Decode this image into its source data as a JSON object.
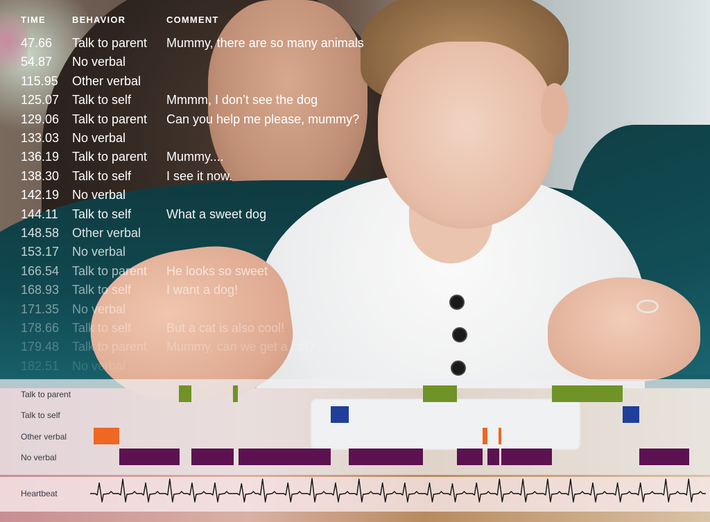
{
  "log": {
    "headers": {
      "time": "TIME",
      "behavior": "BEHAVIOR",
      "comment": "COMMENT"
    },
    "rows": [
      {
        "time": "47.66",
        "behavior": "Talk to parent",
        "comment": "Mummy, there are so many animals",
        "opacity": 1.0
      },
      {
        "time": "54.87",
        "behavior": "No verbal",
        "comment": "",
        "opacity": 1.0
      },
      {
        "time": "115.95",
        "behavior": "Other verbal",
        "comment": "",
        "opacity": 1.0
      },
      {
        "time": "125.07",
        "behavior": "Talk to self",
        "comment": "Mmmm, I don’t see the dog",
        "opacity": 1.0
      },
      {
        "time": "129.06",
        "behavior": "Talk to parent",
        "comment": "Can you help me please, mummy?",
        "opacity": 1.0
      },
      {
        "time": "133.03",
        "behavior": "No verbal",
        "comment": "",
        "opacity": 1.0
      },
      {
        "time": "136.19",
        "behavior": "Talk to parent",
        "comment": "Mummy....",
        "opacity": 1.0
      },
      {
        "time": "138.30",
        "behavior": "Talk to self",
        "comment": "I see it now.",
        "opacity": 1.0
      },
      {
        "time": "142.19",
        "behavior": "No verbal",
        "comment": "",
        "opacity": 1.0
      },
      {
        "time": "144.11",
        "behavior": "Talk to self",
        "comment": "What a sweet dog",
        "opacity": 0.95
      },
      {
        "time": "148.58",
        "behavior": "Other verbal",
        "comment": "",
        "opacity": 0.85
      },
      {
        "time": "153.17",
        "behavior": "No verbal",
        "comment": "",
        "opacity": 0.75
      },
      {
        "time": "166.54",
        "behavior": "Talk to parent",
        "comment": "He looks so sweet",
        "opacity": 0.65
      },
      {
        "time": "168.93",
        "behavior": "Talk to self",
        "comment": "I want a dog!",
        "opacity": 0.55
      },
      {
        "time": "171.35",
        "behavior": "No verbal",
        "comment": "",
        "opacity": 0.45
      },
      {
        "time": "178.66",
        "behavior": "Talk to self",
        "comment": "But a cat is also cool!",
        "opacity": 0.35
      },
      {
        "time": "179.48",
        "behavior": "Talk to parent",
        "comment": "Mummy, can we get a cat?",
        "opacity": 0.25
      },
      {
        "time": "182.51",
        "behavior": "No verbal",
        "comment": "",
        "opacity": 0.15
      }
    ]
  },
  "chart_data": {
    "type": "timeline",
    "title": "",
    "x_unit": "fraction of session",
    "xlim": [
      0,
      1
    ],
    "grid": false,
    "categories": [
      "Talk to parent",
      "Talk to self",
      "Other verbal",
      "No verbal"
    ],
    "colors": {
      "Talk to parent": "#6f9326",
      "Talk to self": "#1f3f9a",
      "Other verbal": "#ee6723",
      "No verbal": "#5c1250"
    },
    "series": [
      {
        "name": "Talk to parent",
        "segments": [
          [
            0.147,
            0.168
          ],
          [
            0.237,
            0.245
          ],
          [
            0.552,
            0.608
          ],
          [
            0.766,
            0.883
          ]
        ]
      },
      {
        "name": "Talk to self",
        "segments": [
          [
            0.399,
            0.429
          ],
          [
            0.883,
            0.91
          ]
        ]
      },
      {
        "name": "Other verbal",
        "segments": [
          [
            0.006,
            0.048
          ],
          [
            0.651,
            0.659
          ],
          [
            0.677,
            0.682
          ]
        ]
      },
      {
        "name": "No verbal",
        "segments": [
          [
            0.048,
            0.148
          ],
          [
            0.168,
            0.238
          ],
          [
            0.246,
            0.399
          ],
          [
            0.429,
            0.552
          ],
          [
            0.608,
            0.651
          ],
          [
            0.659,
            0.678
          ],
          [
            0.682,
            0.766
          ],
          [
            0.91,
            0.993
          ]
        ]
      }
    ],
    "heartbeat": {
      "label": "Heartbeat",
      "beats": [
        0.017,
        0.055,
        0.092,
        0.131,
        0.167,
        0.204,
        0.247,
        0.281,
        0.322,
        0.361,
        0.399,
        0.437,
        0.475,
        0.511,
        0.551,
        0.588,
        0.627,
        0.664,
        0.702,
        0.742,
        0.779,
        0.815,
        0.855,
        0.892,
        0.933,
        0.97
      ],
      "amplitudes": [
        0.7,
        0.95,
        0.7,
        0.95,
        0.7,
        0.7,
        0.65,
        0.95,
        0.7,
        1.0,
        0.7,
        0.95,
        0.7,
        0.7,
        0.7,
        0.65,
        0.7,
        0.95,
        0.95,
        0.95,
        0.95,
        0.7,
        0.7,
        0.7,
        0.95,
        0.95
      ]
    }
  }
}
